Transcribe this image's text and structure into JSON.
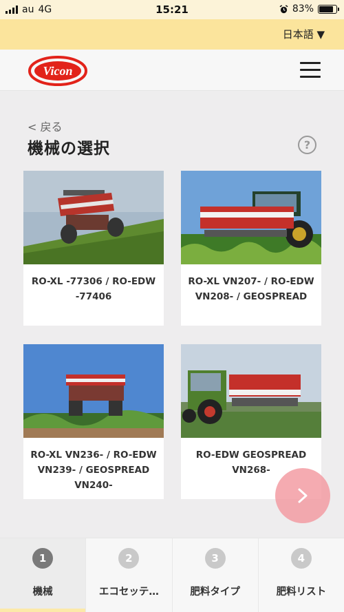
{
  "status_bar": {
    "carrier": "au",
    "network": "4G",
    "time": "15:21",
    "battery": "83%",
    "battery_level": 0.83
  },
  "language": {
    "selected": "日本語 ▼"
  },
  "header": {
    "logo_text": "Vicon",
    "menu_icon": "hamburger-menu-icon"
  },
  "nav": {
    "back_label": "< 戻る",
    "page_title": "機械の選択",
    "help_label": "?"
  },
  "machines": [
    {
      "name": "RO-XL -77306 / RO-EDW -77406"
    },
    {
      "name": "RO-XL VN207- / RO-EDW VN208- / GEOSPREAD"
    },
    {
      "name": "RO-XL VN236- / RO-EDW VN239- / GEOSPREAD VN240-"
    },
    {
      "name": "RO-EDW GEOSPREAD VN268-"
    }
  ],
  "next_button": {
    "icon": "chevron-right-icon"
  },
  "tabs": [
    {
      "number": "1",
      "label": "機械",
      "active": true
    },
    {
      "number": "2",
      "label": "エコセッテ…",
      "active": false
    },
    {
      "number": "3",
      "label": "肥料タイプ",
      "active": false
    },
    {
      "number": "4",
      "label": "肥料リスト",
      "active": false
    }
  ],
  "colors": {
    "brand_red": "#e2231a",
    "language_bar": "#fbe49c",
    "status_bar": "#fcf3d8",
    "fab": "#f2969e",
    "active_tab_underline": "#fce9a8"
  }
}
